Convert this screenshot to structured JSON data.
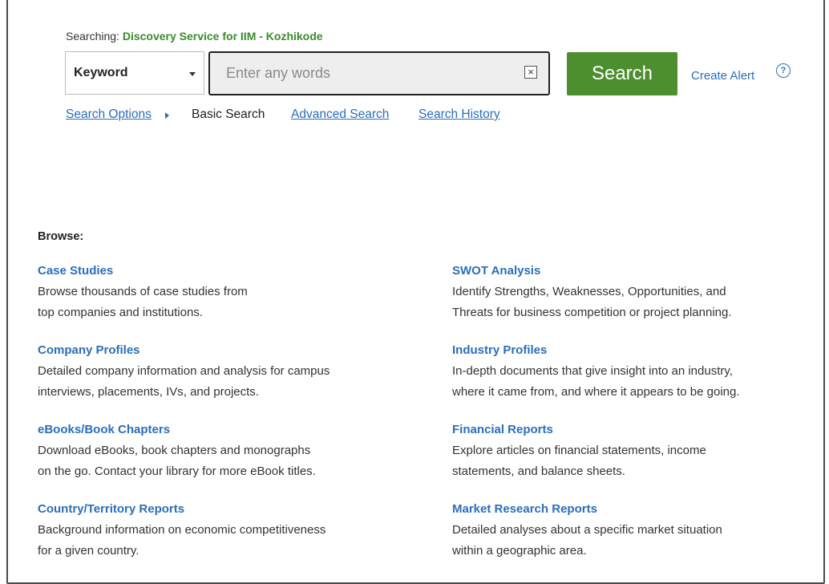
{
  "searching": {
    "prefix": "Searching:",
    "database": "Discovery Service for IIM - Kozhikode"
  },
  "search": {
    "field_selected": "Keyword",
    "placeholder": "Enter any words",
    "clear_glyph": "×",
    "button_label": "Search",
    "create_alert": "Create Alert",
    "help_glyph": "?"
  },
  "links": {
    "search_options": "Search Options",
    "basic_search": "Basic Search",
    "advanced_search": "Advanced Search",
    "search_history": "Search History"
  },
  "browse": {
    "label": "Browse:",
    "items": [
      {
        "title": "Case Studies",
        "desc_line1": "Browse thousands of case studies from",
        "desc_line2": "top companies and institutions."
      },
      {
        "title": "SWOT Analysis",
        "desc_line1": "Identify Strengths, Weaknesses, Opportunities, and",
        "desc_line2": "Threats for business competition or project planning."
      },
      {
        "title": "Company Profiles",
        "desc_line1": "Detailed company information and analysis for campus",
        "desc_line2": "interviews, placements, IVs, and projects."
      },
      {
        "title": "Industry Profiles",
        "desc_line1": "In-depth documents that give insight into an industry,",
        "desc_line2": "where it came from, and where it appears to be going."
      },
      {
        "title": "eBooks/Book Chapters",
        "desc_line1": "Download eBooks, book chapters and monographs",
        "desc_line2": "on the go. Contact your library for more eBook titles."
      },
      {
        "title": "Financial Reports",
        "desc_line1": "Explore articles on financial statements, income",
        "desc_line2": "statements, and balance sheets."
      },
      {
        "title": "Country/Territory Reports",
        "desc_line1": "Background information on economic competitiveness",
        "desc_line2": "for a given country."
      },
      {
        "title": "Market Research Reports",
        "desc_line1": "Detailed analyses about a specific market situation",
        "desc_line2": "within a geographic area."
      }
    ]
  },
  "colors": {
    "accent_green": "#4d8f2e",
    "link_blue": "#2a6ebb",
    "db_green": "#3c8a2e"
  }
}
